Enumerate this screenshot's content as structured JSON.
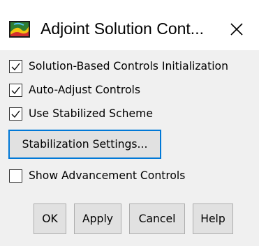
{
  "window": {
    "title": "Adjoint Solution Cont...",
    "icon": "app-icon",
    "close_icon": "close-icon"
  },
  "options": [
    {
      "label": "Solution-Based Controls Initialization",
      "checked": true
    },
    {
      "label": "Auto-Adjust Controls",
      "checked": true
    },
    {
      "label": "Use Stabilized Scheme",
      "checked": true
    },
    {
      "label": "Show Advancement Controls",
      "checked": false
    }
  ],
  "stabilization_button": {
    "label": "Stabilization Settings..."
  },
  "buttons": {
    "ok": "OK",
    "apply": "Apply",
    "cancel": "Cancel",
    "help": "Help"
  },
  "colors": {
    "panel_bg": "#f0f0f0",
    "focus_border": "#0078d7",
    "button_bg": "#e1e1e1"
  }
}
